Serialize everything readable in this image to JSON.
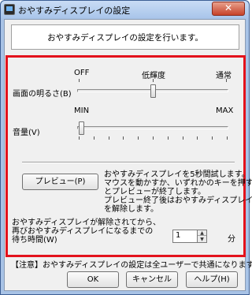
{
  "window": {
    "title": "おやすみディスプレイの設定",
    "close_label": "✕"
  },
  "header": {
    "text": "おやすみディスプレイの設定を行います。"
  },
  "brightness": {
    "label": "画面の明るさ(B)",
    "min_label": "OFF",
    "mid_label": "低輝度",
    "max_label": "通常",
    "value_fraction": 0.5
  },
  "volume": {
    "label": "音量(V)",
    "min_label": "MIN",
    "max_label": "MAX",
    "value_fraction": 0.0
  },
  "preview": {
    "button_label": "プレビュー(P)",
    "description": [
      "おやすみディスプレイを5秒間試します。",
      "マウスを動かすか、いずれかのキーを押す",
      "とプレビューが終了します。",
      "プレビュー終了後はおやすみディスプレイ",
      "を解除します。"
    ]
  },
  "timeout": {
    "description": [
      "おやすみディスプレイが解除されてから、",
      "再びおやすみディスプレイになるまでの",
      "待ち時間(W)"
    ],
    "value": "1",
    "unit": "分"
  },
  "note": "【注意】おやすみディスプレイの設定は全ユーザーで共通になります。",
  "buttons": {
    "ok": "OK",
    "cancel": "キャンセル",
    "help": "ヘルプ(H)"
  }
}
